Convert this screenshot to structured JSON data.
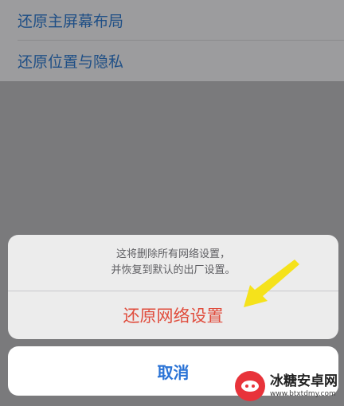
{
  "settings": {
    "items": [
      {
        "label": "还原主屏幕布局"
      },
      {
        "label": "还原位置与隐私"
      }
    ]
  },
  "action_sheet": {
    "message_line1": "这将删除所有网络设置，",
    "message_line2": "并恢复到默认的出厂设置。",
    "action_label": "还原网络设置",
    "cancel_label": "取消"
  },
  "watermark": {
    "title": "冰糖安卓网",
    "url": "www.btxtdmy.com"
  },
  "colors": {
    "link_blue": "#1f4f86",
    "destructive_red": "#e04c3c",
    "cancel_blue": "#2a73d6",
    "arrow_yellow": "#f5e21b"
  },
  "icons": {
    "annotation": "arrow-icon",
    "watermark_logo": "logo-icon"
  }
}
